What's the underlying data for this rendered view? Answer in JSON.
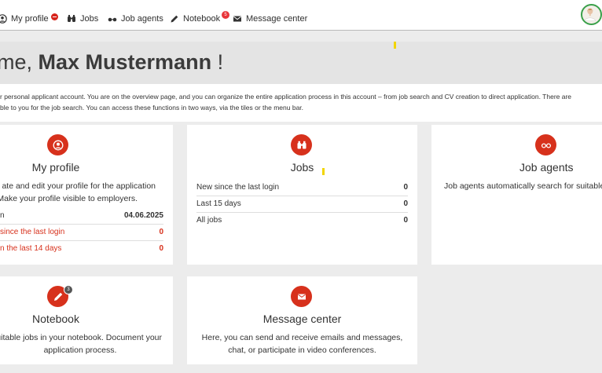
{
  "nav": {
    "items": [
      {
        "label": "My profile",
        "icon": "user-circle-icon",
        "badge": ""
      },
      {
        "label": "Jobs",
        "icon": "binoculars-icon"
      },
      {
        "label": "Job agents",
        "icon": "glasses-icon"
      },
      {
        "label": "Notebook",
        "icon": "pencil-icon",
        "badge": "5"
      },
      {
        "label": "Message center",
        "icon": "envelope-icon"
      }
    ]
  },
  "hero": {
    "greeting": "me, ",
    "name": "Max Mustermann",
    "suffix": " !"
  },
  "intro": {
    "line1": "r personal applicant account. You are on the overview page, and you can organize the entire application process in this account – from job search and CV creation to direct application. There are",
    "line2": "ble to you for the job search. You can access these functions in two ways, via the tiles or the menu bar."
  },
  "cards": {
    "profile": {
      "title": "My profile",
      "desc1": "ate and edit your profile for the application",
      "desc2": "Make your profile visible to employers.",
      "rows": [
        {
          "label": "n",
          "value": "04.06.2025"
        },
        {
          "label": "since the last login",
          "value": "0"
        },
        {
          "label": "n the last 14 days",
          "value": "0"
        }
      ]
    },
    "jobs": {
      "title": "Jobs",
      "rows": [
        {
          "label": "New since the last login",
          "value": "0"
        },
        {
          "label": "Last 15 days",
          "value": "0"
        },
        {
          "label": "All jobs",
          "value": "0"
        }
      ]
    },
    "agents": {
      "title": "Job agents",
      "desc1": "Job agents automatically search for suitable"
    },
    "notebook": {
      "title": "Notebook",
      "badge": "3",
      "desc1": "uitable jobs in your notebook. Document your",
      "desc2": "application process."
    },
    "messages": {
      "title": "Message center",
      "desc1": "Here, you can send and receive emails and messages,",
      "desc2": "chat, or participate in video conferences."
    }
  },
  "colors": {
    "accent": "#d7311c",
    "badge": "#e8353a",
    "avatar_ring": "#3aa04a",
    "highlight": "#f2d500"
  }
}
